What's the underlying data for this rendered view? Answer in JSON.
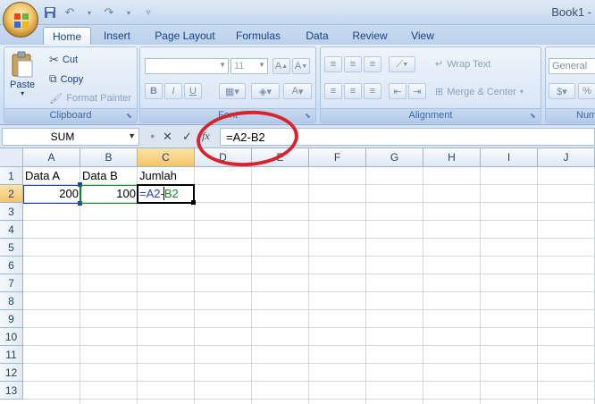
{
  "window": {
    "title": "Book1 -"
  },
  "quick_access": {
    "icons": [
      "save-icon",
      "undo-icon",
      "redo-icon",
      "customize-icon"
    ]
  },
  "tabs": [
    {
      "label": "Home",
      "active": true
    },
    {
      "label": "Insert"
    },
    {
      "label": "Page Layout"
    },
    {
      "label": "Formulas"
    },
    {
      "label": "Data"
    },
    {
      "label": "Review"
    },
    {
      "label": "View"
    }
  ],
  "ribbon": {
    "clipboard": {
      "paste": "Paste",
      "cut": "Cut",
      "copy": "Copy",
      "format_painter": "Format Painter",
      "label": "Clipboard"
    },
    "font": {
      "size": "11",
      "label": "Font"
    },
    "alignment": {
      "wrap_text": "Wrap Text",
      "merge_center": "Merge & Center",
      "label": "Alignment"
    },
    "number": {
      "format": "General",
      "percent": "%",
      "label": "Num"
    }
  },
  "formula_bar": {
    "name_box": "SUM",
    "cancel": "✕",
    "enter": "✓",
    "fx": "fx",
    "formula": "=A2-B2"
  },
  "grid": {
    "columns": [
      "A",
      "B",
      "C",
      "D",
      "E",
      "F",
      "G",
      "H",
      "I",
      "J"
    ],
    "rows": [
      "1",
      "2",
      "3",
      "4",
      "5",
      "6",
      "7",
      "8",
      "9",
      "10",
      "11",
      "12",
      "13"
    ],
    "cells": {
      "A1": "Data A",
      "B1": "Data B",
      "C1": "Jumlah",
      "A2": "200",
      "B2": "100",
      "C2_ref1": "=A2-",
      "C2_ref2": "B2"
    }
  },
  "colors": {
    "ref_a": "#1f3fbf",
    "ref_b": "#1c8a2a",
    "annotation": "#d9232d"
  }
}
